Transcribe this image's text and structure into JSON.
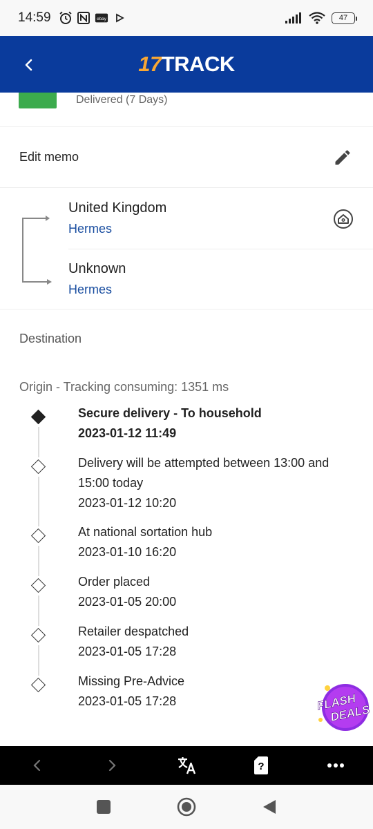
{
  "status_bar": {
    "time": "14:59",
    "battery": "47",
    "left_icons": [
      "alarm-icon",
      "nfc-icon",
      "ebay-icon",
      "play-icon"
    ],
    "right_icons": [
      "signal-icon",
      "wifi-icon",
      "battery-icon"
    ]
  },
  "header": {
    "logo_number": "17",
    "logo_text": "TRACK",
    "back_icon": "chevron-left-icon",
    "brand_color": "#0a3b9c",
    "logo_accent": "#f8a634"
  },
  "package": {
    "status_label": "Delivered (7 Days)",
    "status_color": "#3cab4d"
  },
  "memo": {
    "label": "Edit memo",
    "icon": "pencil-icon"
  },
  "route": {
    "origin_country": "United Kingdom",
    "origin_carrier": "Hermes",
    "destination_country": "Unknown",
    "destination_carrier": "Hermes",
    "home_icon": "home-circle-icon"
  },
  "sections": {
    "destination_label": "Destination",
    "origin_label": "Origin - Tracking consuming: 1351 ms"
  },
  "events": [
    {
      "text": "Secure delivery - To household",
      "time": "2023-01-12 11:49",
      "current": true
    },
    {
      "text": "Delivery will be attempted between 13:00 and 15:00 today",
      "time": "2023-01-12 10:20",
      "current": false
    },
    {
      "text": "At national sortation hub",
      "time": "2023-01-10 16:20",
      "current": false
    },
    {
      "text": "Order placed",
      "time": "2023-01-05 20:00",
      "current": false
    },
    {
      "text": "Retailer despatched",
      "time": "2023-01-05 17:28",
      "current": false
    },
    {
      "text": "Missing Pre-Advice",
      "time": "2023-01-05 17:28",
      "current": false
    }
  ],
  "flash_deals": {
    "line1": "FLASH",
    "line2": "DEALS"
  },
  "browser_bar": {
    "icons": [
      "back-arrow-icon",
      "forward-arrow-icon",
      "translate-icon",
      "help-card-icon",
      "more-icon"
    ]
  },
  "nav_bar": {
    "icons": [
      "recent-apps-icon",
      "home-icon",
      "back-icon"
    ]
  }
}
